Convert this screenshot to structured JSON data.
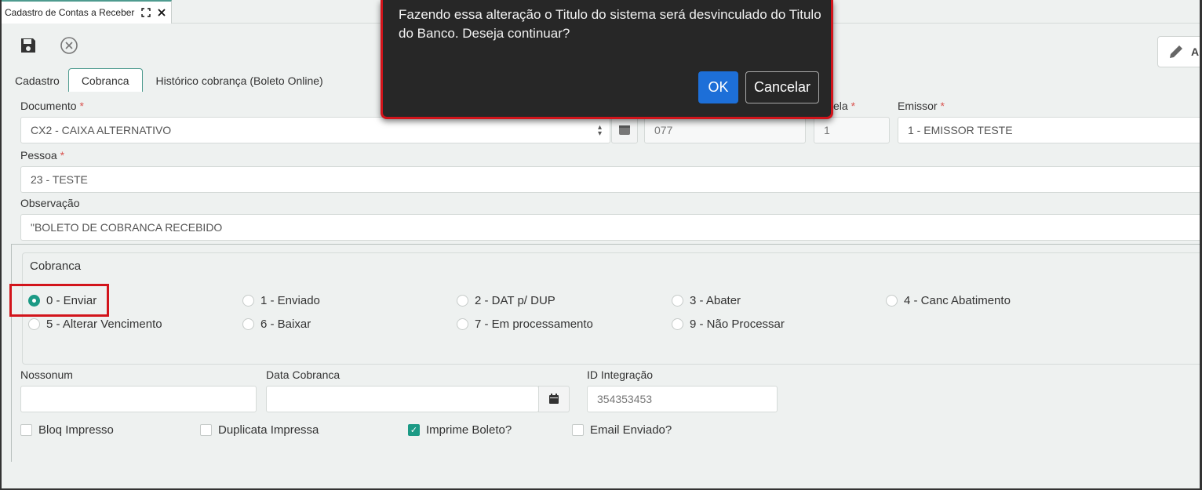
{
  "window_tab": {
    "title": "Cadastro de Contas a Receber",
    "expand_icon": "expand-icon",
    "close_icon": "close-icon"
  },
  "toolbar": {
    "save_icon": "save-icon",
    "cancel_icon": "cancel-circle-icon",
    "alter_label": "Alt",
    "alter_icon": "pencil-icon"
  },
  "tabs": [
    {
      "label": "Cadastro"
    },
    {
      "label": "Cobranca"
    },
    {
      "label": "Histórico cobrança (Boleto Online)"
    }
  ],
  "form": {
    "documento": {
      "label": "Documento",
      "required": "*",
      "value": "CX2 - CAIXA ALTERNATIVO"
    },
    "numero": {
      "value": "077"
    },
    "parcela": {
      "label": "ela",
      "required": "*",
      "value": "1"
    },
    "emissor": {
      "label": "Emissor",
      "required": "*",
      "value": "1 - EMISSOR TESTE"
    },
    "pessoa": {
      "label": "Pessoa",
      "required": "*",
      "value": "23 - TESTE"
    },
    "observacao": {
      "label": "Observação",
      "value": "\"BOLETO DE COBRANCA RECEBIDO"
    }
  },
  "cobranca": {
    "legend": "Cobranca",
    "options": [
      {
        "label": "0 - Enviar",
        "selected": true
      },
      {
        "label": "1 - Enviado",
        "selected": false
      },
      {
        "label": "2 - DAT p/ DUP",
        "selected": false
      },
      {
        "label": "3 - Abater",
        "selected": false
      },
      {
        "label": "4 - Canc Abatimento",
        "selected": false
      },
      {
        "label": "5 - Alterar Vencimento",
        "selected": false
      },
      {
        "label": "6 - Baixar",
        "selected": false
      },
      {
        "label": "7 - Em processamento",
        "selected": false
      },
      {
        "label": "9 - Não Processar",
        "selected": false
      }
    ],
    "nossonum": {
      "label": "Nossonum",
      "value": ""
    },
    "data_cobranca": {
      "label": "Data Cobranca",
      "value": ""
    },
    "id_integracao": {
      "label": "ID Integração",
      "value": "354353453"
    },
    "checkboxes": [
      {
        "label": "Bloq Impresso",
        "checked": false
      },
      {
        "label": "Duplicata Impressa",
        "checked": false
      },
      {
        "label": "Imprime Boleto?",
        "checked": true
      },
      {
        "label": "Email Enviado?",
        "checked": false
      }
    ]
  },
  "modal": {
    "message": "Fazendo essa alteração o Titulo do sistema será desvinculado do Titulo do Banco. Deseja continuar?",
    "ok_label": "OK",
    "cancel_label": "Cancelar"
  },
  "colors": {
    "accent": "#1b9a85",
    "highlight": "#d2141b",
    "primary_button": "#1d6fd8",
    "modal_bg": "#272727"
  }
}
